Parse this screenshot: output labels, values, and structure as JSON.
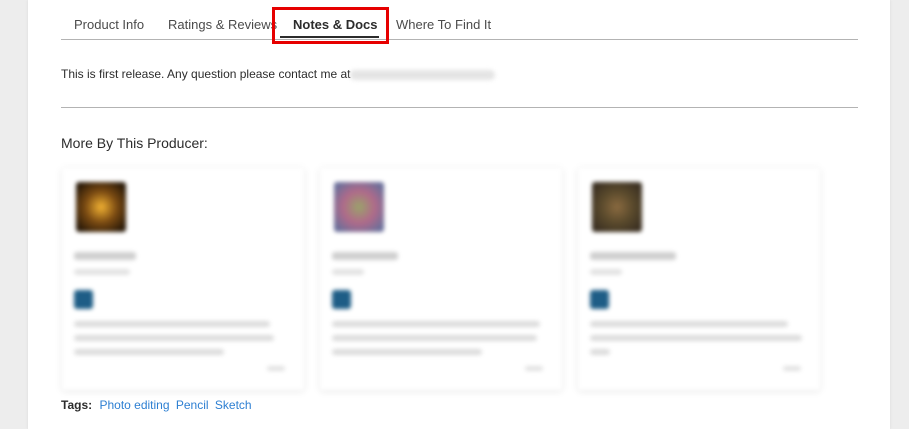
{
  "tabs": [
    {
      "label": "Product Info"
    },
    {
      "label": "Ratings & Reviews"
    },
    {
      "label": "Notes & Docs",
      "active": true
    },
    {
      "label": "Where To Find It"
    }
  ],
  "notes": {
    "text": "This is first release. Any question please contact me at"
  },
  "more_section": {
    "title": "More By This Producer:"
  },
  "cards": [
    {
      "thumb_colors": [
        "#2a1a08",
        "#f2b233",
        "#7a4a12"
      ]
    },
    {
      "thumb_colors": [
        "#6b6f9a",
        "#9aa36a",
        "#b06a8a"
      ]
    },
    {
      "thumb_colors": [
        "#3b3022",
        "#8a6a40",
        "#5a4a2c"
      ]
    }
  ],
  "tags": {
    "label": "Tags:",
    "items": [
      "Photo editing",
      "Pencil",
      "Sketch"
    ]
  },
  "colors": {
    "highlight": "#e60000",
    "link": "#2d7fd2",
    "badge": "#1e5d86"
  }
}
